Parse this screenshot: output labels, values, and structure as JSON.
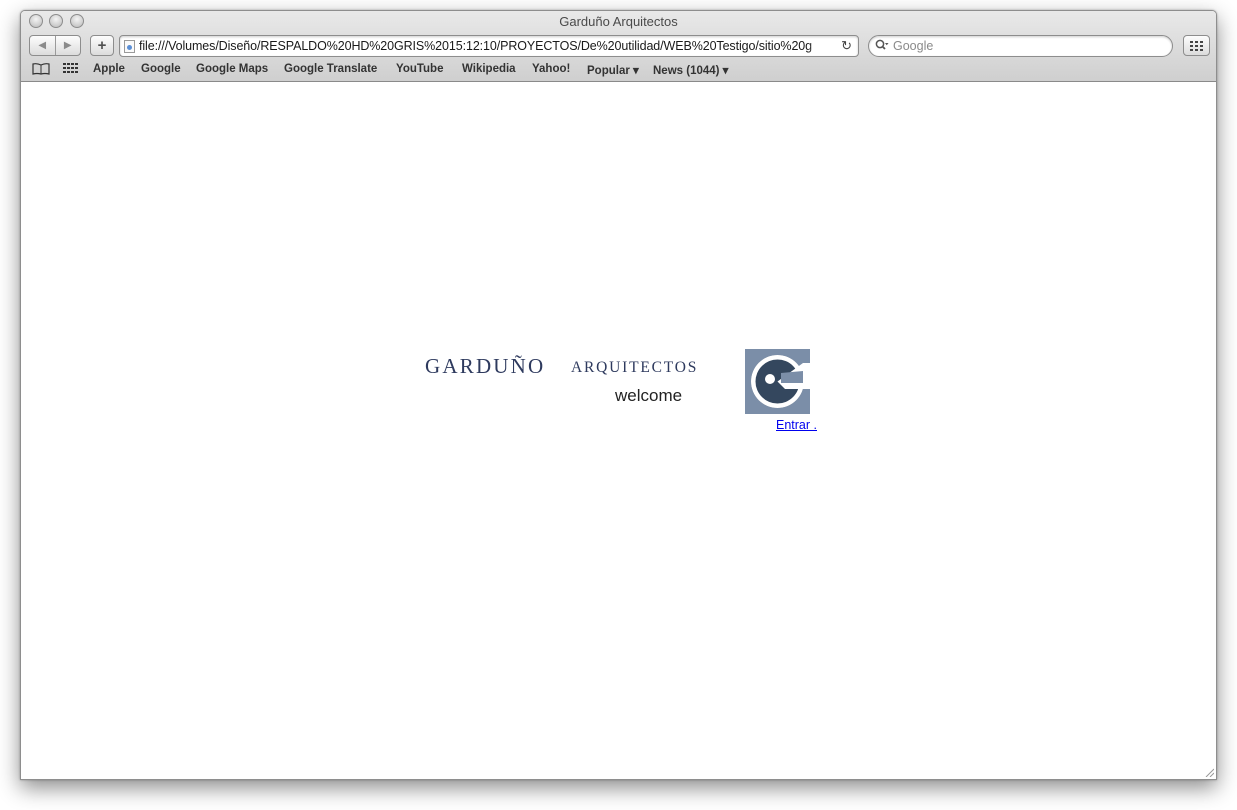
{
  "window": {
    "title": "Garduño Arquitectos"
  },
  "toolbar": {
    "back_label": "◀",
    "forward_label": "▶",
    "add_label": "+",
    "url": "file:///Volumes/Diseño/RESPALDO%20HD%20GRIS%2015:12:10/PROYECTOS/De%20utilidad/WEB%20Testigo/sitio%20g",
    "search_placeholder": "Google"
  },
  "bookmarks": {
    "items": [
      {
        "label": "Apple"
      },
      {
        "label": "Google"
      },
      {
        "label": "Google Maps"
      },
      {
        "label": "Google Translate"
      },
      {
        "label": "YouTube"
      },
      {
        "label": "Wikipedia"
      },
      {
        "label": "Yahoo!"
      },
      {
        "label": "Popular ▾"
      },
      {
        "label": "News (1044) ▾"
      }
    ]
  },
  "page": {
    "brand_name": "GARDUÑO",
    "brand_sub": "ARQUITECTOS",
    "welcome": "welcome",
    "enter_link": "Entrar ."
  },
  "colors": {
    "brand_text": "#2e3a5e",
    "emblem_dark": "#34475e",
    "emblem_light": "#7b8ea8",
    "link": "#0000ee"
  }
}
